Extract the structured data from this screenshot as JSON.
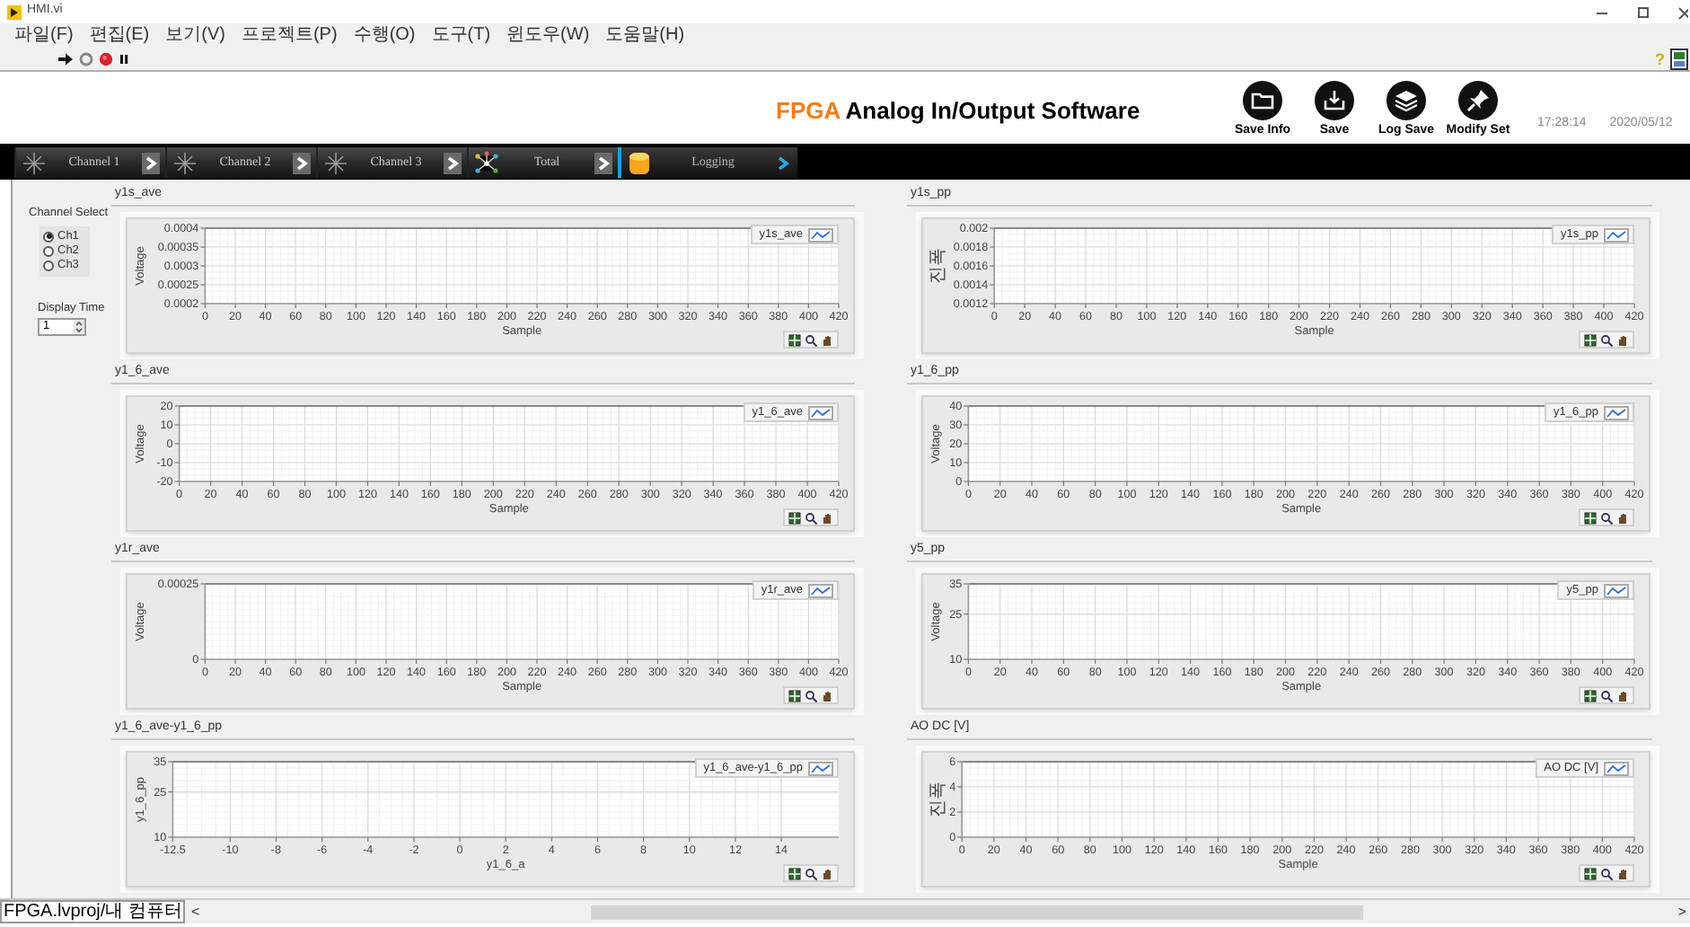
{
  "window": {
    "title": "HMI.vi"
  },
  "menu": [
    "파일(F)",
    "편집(E)",
    "보기(V)",
    "프로젝트(P)",
    "수행(O)",
    "도구(T)",
    "윈도우(W)",
    "도움말(H)"
  ],
  "toolbar": {
    "help": "?"
  },
  "header": {
    "title_accent": "FPGA",
    "title": "Analog In/Output Software",
    "time": "17:28:14",
    "date": "2020/05/12",
    "buttons": [
      {
        "label": "Save Info"
      },
      {
        "label": "Save"
      },
      {
        "label": "Log Save"
      },
      {
        "label": "Modify Set"
      }
    ]
  },
  "tabs": [
    {
      "label": "Channel 1",
      "selected": false
    },
    {
      "label": "Channel 2",
      "selected": false
    },
    {
      "label": "Channel 3",
      "selected": false
    },
    {
      "label": "Total",
      "selected": false
    },
    {
      "label": "Logging",
      "selected": true
    }
  ],
  "side": {
    "channel_select": {
      "label": "Channel Select",
      "options": [
        {
          "label": "Ch1",
          "selected": true
        },
        {
          "label": "Ch2",
          "selected": false
        },
        {
          "label": "Ch3",
          "selected": false
        }
      ]
    },
    "display_time": {
      "label": "Display Time",
      "value": "1"
    }
  },
  "charts": [
    {
      "title": "y1s_ave",
      "legend": "y1s_ave",
      "chart_data": {
        "type": "line",
        "grid": true,
        "xlabel": "Sample",
        "ylabel": "Voltage",
        "xlim": [
          0,
          420
        ],
        "ylim": [
          0.0002,
          0.0004
        ],
        "xticks": [
          0,
          20,
          40,
          60,
          80,
          100,
          120,
          140,
          160,
          180,
          200,
          220,
          240,
          260,
          280,
          300,
          320,
          340,
          360,
          380,
          400,
          420
        ],
        "yticks": [
          0.0002,
          0.00025,
          0.0003,
          0.00035,
          0.0004
        ]
      }
    },
    {
      "title": "y1s_pp",
      "legend": "y1s_pp",
      "chart_data": {
        "type": "line",
        "grid": true,
        "xlabel": "Sample",
        "ylabel": "진폭",
        "xlim": [
          0,
          420
        ],
        "ylim": [
          0.0012,
          0.002
        ],
        "xticks": [
          0,
          20,
          40,
          60,
          80,
          100,
          120,
          140,
          160,
          180,
          200,
          220,
          240,
          260,
          280,
          300,
          320,
          340,
          360,
          380,
          400,
          420
        ],
        "yticks": [
          0.0012,
          0.0014,
          0.0016,
          0.0018,
          0.002
        ]
      }
    },
    {
      "title": "y1_6_ave",
      "legend": "y1_6_ave",
      "chart_data": {
        "type": "line",
        "grid": true,
        "xlabel": "Sample",
        "ylabel": "Voltage",
        "xlim": [
          0,
          420
        ],
        "ylim": [
          -20,
          20
        ],
        "xticks": [
          0,
          20,
          40,
          60,
          80,
          100,
          120,
          140,
          160,
          180,
          200,
          220,
          240,
          260,
          280,
          300,
          320,
          340,
          360,
          380,
          400,
          420
        ],
        "yticks": [
          -20,
          -10,
          0,
          10,
          20
        ]
      }
    },
    {
      "title": "y1_6_pp",
      "legend": "y1_6_pp",
      "chart_data": {
        "type": "line",
        "grid": true,
        "xlabel": "Sample",
        "ylabel": "Voltage",
        "xlim": [
          0,
          420
        ],
        "ylim": [
          0,
          40
        ],
        "xticks": [
          0,
          20,
          40,
          60,
          80,
          100,
          120,
          140,
          160,
          180,
          200,
          220,
          240,
          260,
          280,
          300,
          320,
          340,
          360,
          380,
          400,
          420
        ],
        "yticks": [
          0,
          10,
          20,
          30,
          40
        ]
      }
    },
    {
      "title": "y1r_ave",
      "legend": "y1r_ave",
      "chart_data": {
        "type": "line",
        "grid": true,
        "xlabel": "Sample",
        "ylabel": "Voltage",
        "xlim": [
          0,
          420
        ],
        "ylim": [
          0,
          0.00025
        ],
        "xticks": [
          0,
          20,
          40,
          60,
          80,
          100,
          120,
          140,
          160,
          180,
          200,
          220,
          240,
          260,
          280,
          300,
          320,
          340,
          360,
          380,
          400,
          420
        ],
        "yticks": [
          0,
          0.00025
        ]
      }
    },
    {
      "title": "y5_pp",
      "legend": "y5_pp",
      "chart_data": {
        "type": "line",
        "grid": true,
        "xlabel": "Sample",
        "ylabel": "Voltage",
        "xlim": [
          0,
          420
        ],
        "ylim": [
          10,
          35
        ],
        "xticks": [
          0,
          20,
          40,
          60,
          80,
          100,
          120,
          140,
          160,
          180,
          200,
          220,
          240,
          260,
          280,
          300,
          320,
          340,
          360,
          380,
          400,
          420
        ],
        "yticks": [
          10,
          25,
          35
        ]
      }
    },
    {
      "title": "y1_6_ave-y1_6_pp",
      "legend": "y1_6_ave-y1_6_pp",
      "chart_data": {
        "type": "line",
        "grid": true,
        "xlabel": "y1_6_a",
        "ylabel": "y1_6_pp",
        "xlim": [
          -12.5,
          16.5
        ],
        "ylim": [
          10,
          35
        ],
        "xticks": [
          -12.5,
          -10,
          -8,
          -6,
          -4,
          -2,
          0,
          2,
          4,
          6,
          8,
          10,
          12,
          14
        ],
        "yticks": [
          10,
          25,
          35
        ]
      }
    },
    {
      "title": "AO DC [V]",
      "legend": "AO DC [V]",
      "chart_data": {
        "type": "line",
        "grid": true,
        "xlabel": "Sample",
        "ylabel": "진폭",
        "xlim": [
          0,
          420
        ],
        "ylim": [
          0,
          6
        ],
        "xticks": [
          0,
          20,
          40,
          60,
          80,
          100,
          120,
          140,
          160,
          180,
          200,
          220,
          240,
          260,
          280,
          300,
          320,
          340,
          360,
          380,
          400,
          420
        ],
        "yticks": [
          0,
          2,
          4,
          6
        ]
      }
    }
  ],
  "status_bar": {
    "path": "FPGA.lvproj/내 컴퓨터",
    "scroll_left": "<",
    "scroll_right": ">"
  }
}
